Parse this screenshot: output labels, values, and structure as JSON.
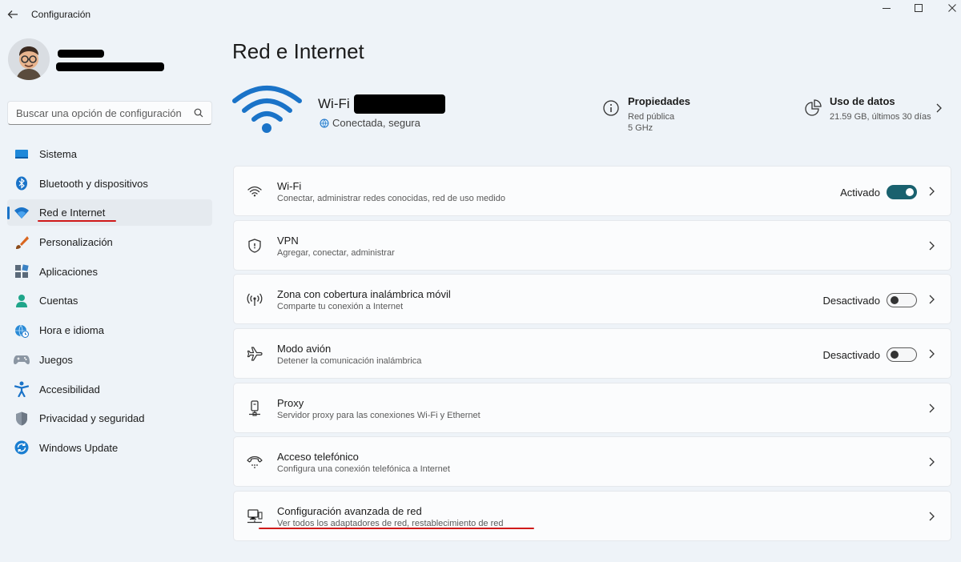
{
  "window": {
    "title": "Configuración"
  },
  "search": {
    "placeholder": "Buscar una opción de configuración"
  },
  "sidebar": {
    "items": [
      {
        "label": "Sistema",
        "icon": "monitor-icon"
      },
      {
        "label": "Bluetooth y dispositivos",
        "icon": "bluetooth-icon"
      },
      {
        "label": "Red e Internet",
        "icon": "wifi-icon",
        "selected": true
      },
      {
        "label": "Personalización",
        "icon": "brush-icon"
      },
      {
        "label": "Aplicaciones",
        "icon": "apps-icon"
      },
      {
        "label": "Cuentas",
        "icon": "person-icon"
      },
      {
        "label": "Hora e idioma",
        "icon": "globe-clock-icon"
      },
      {
        "label": "Juegos",
        "icon": "gamepad-icon"
      },
      {
        "label": "Accesibilidad",
        "icon": "accessibility-icon"
      },
      {
        "label": "Privacidad y seguridad",
        "icon": "shield-icon"
      },
      {
        "label": "Windows Update",
        "icon": "update-icon"
      }
    ]
  },
  "main": {
    "title": "Red e Internet",
    "connection": {
      "name": "Wi-Fi",
      "status": "Conectada, segura"
    },
    "properties": {
      "title": "Propiedades",
      "network_type": "Red pública",
      "band": "5 GHz"
    },
    "data_usage": {
      "title": "Uso de datos",
      "detail": "21.59 GB, últimos 30 días"
    },
    "cards": [
      {
        "title": "Wi-Fi",
        "subtitle": "Conectar, administrar redes conocidas, red de uso medido",
        "state": "Activado",
        "toggle": "on",
        "icon": "wifi-icon"
      },
      {
        "title": "VPN",
        "subtitle": "Agregar, conectar, administrar",
        "icon": "vpn-shield-icon"
      },
      {
        "title": "Zona con cobertura inalámbrica móvil",
        "subtitle": "Comparte tu conexión a Internet",
        "state": "Desactivado",
        "toggle": "off",
        "icon": "hotspot-icon"
      },
      {
        "title": "Modo avión",
        "subtitle": "Detener la comunicación inalámbrica",
        "state": "Desactivado",
        "toggle": "off",
        "icon": "airplane-icon"
      },
      {
        "title": "Proxy",
        "subtitle": "Servidor proxy para las conexiones Wi-Fi y Ethernet",
        "icon": "proxy-icon"
      },
      {
        "title": "Acceso telefónico",
        "subtitle": "Configura una conexión telefónica a Internet",
        "icon": "dialup-icon"
      },
      {
        "title": "Configuración avanzada de red",
        "subtitle": "Ver todos los adaptadores de red, restablecimiento de red",
        "icon": "network-computer-icon"
      }
    ]
  },
  "colors": {
    "accent": "#1a73c8",
    "toggle_on": "#19616e",
    "highlight_underline": "#d01a1a",
    "background": "#eef3f8"
  }
}
